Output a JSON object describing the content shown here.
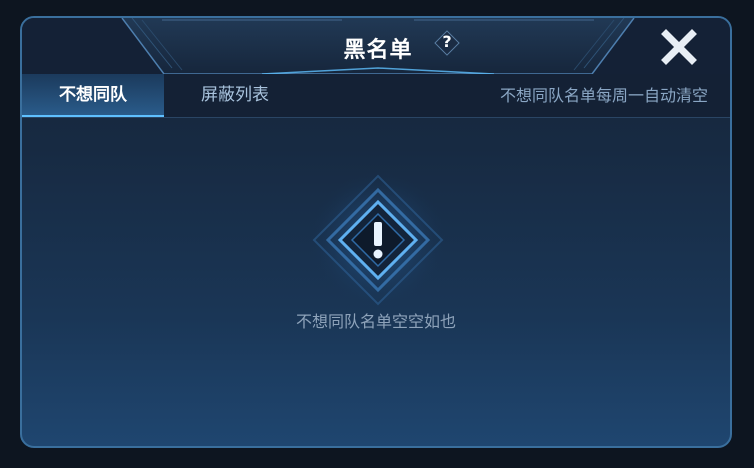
{
  "dialog": {
    "title": "黑名单",
    "help_symbol": "?",
    "close_icon": "close-x-icon"
  },
  "tabs": [
    {
      "label": "不想同队",
      "active": true
    },
    {
      "label": "屏蔽列表",
      "active": false
    }
  ],
  "tab_note": "不想同队名单每周一自动清空",
  "empty_state": {
    "icon": "warning-diamond-icon",
    "message": "不想同队名单空空如也"
  },
  "colors": {
    "accent": "#5fc0ff",
    "frame": "#3a6f9d",
    "text_muted": "#8ea3ba"
  }
}
